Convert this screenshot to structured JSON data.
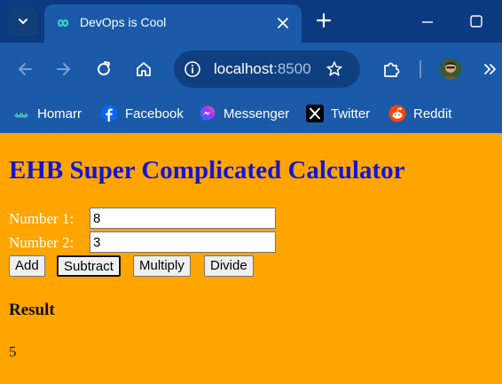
{
  "browser": {
    "tab": {
      "title": "DevOps is Cool"
    },
    "address_bar": {
      "host": "localhost",
      "port": ":8500"
    },
    "bookmarks": [
      {
        "label": "Homarr",
        "icon": "homarr-icon"
      },
      {
        "label": "Facebook",
        "icon": "facebook-icon"
      },
      {
        "label": "Messenger",
        "icon": "messenger-icon"
      },
      {
        "label": "Twitter",
        "icon": "x-twitter-icon"
      },
      {
        "label": "Reddit",
        "icon": "reddit-icon"
      }
    ],
    "colors": {
      "frame": "#0b3a80",
      "toolbar": "#1b5aa8",
      "page_background": "#ffa500",
      "heading": "#1414d8"
    }
  },
  "page": {
    "heading": "EHB Super Complicated Calculator",
    "number1": {
      "label": "Number 1:",
      "value": "8"
    },
    "number2": {
      "label": "Number 2:",
      "value": "3"
    },
    "buttons": {
      "add": "Add",
      "subtract": "Subtract",
      "multiply": "Multiply",
      "divide": "Divide"
    },
    "focused_button": "Subtract",
    "result": {
      "heading": "Result",
      "value": "5"
    }
  }
}
